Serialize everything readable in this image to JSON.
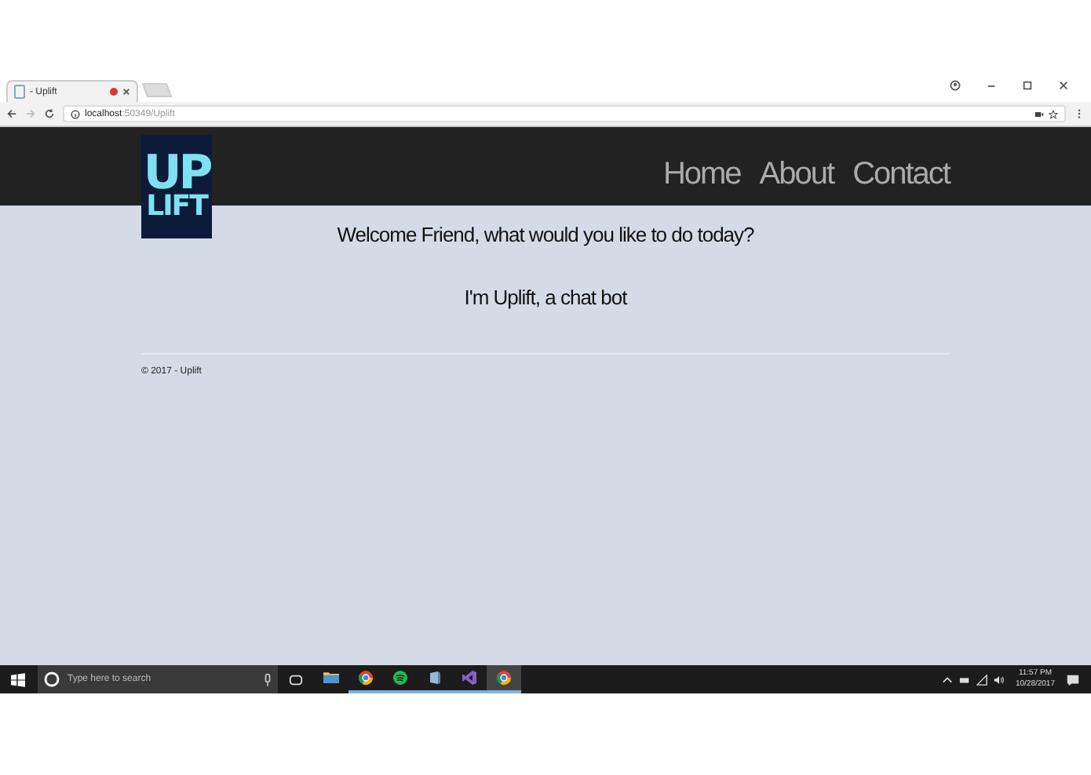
{
  "browser": {
    "tab": {
      "title": "- Uplift"
    },
    "url_host": "localhost",
    "url_path": ":50349/Uplift"
  },
  "site": {
    "logo": [
      "UP",
      "LIFT"
    ],
    "nav": [
      "Home",
      "About",
      "Contact"
    ],
    "welcome": "Welcome Friend, what would you like to do today?",
    "intro": "I'm Uplift, a chat bot",
    "footer": "© 2017 - Uplift"
  },
  "taskbar": {
    "search_placeholder": "Type here to search",
    "apps": [
      {
        "kind": "folder",
        "running": false,
        "selected": false
      },
      {
        "kind": "browser",
        "running": true,
        "selected": false
      },
      {
        "kind": "music",
        "running": true,
        "selected": false
      },
      {
        "kind": "app",
        "running": true,
        "selected": false
      },
      {
        "kind": "ide",
        "running": true,
        "selected": false
      },
      {
        "kind": "browser",
        "running": true,
        "selected": true
      }
    ],
    "time": "11:57 PM",
    "date": "10/28/2017"
  }
}
